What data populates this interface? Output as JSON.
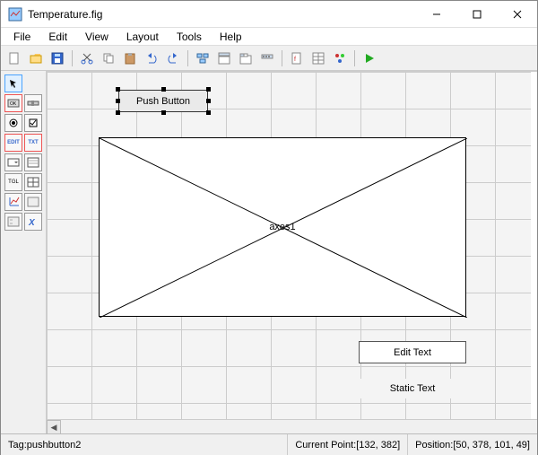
{
  "window": {
    "title": "Temperature.fig"
  },
  "menus": {
    "file": "File",
    "edit": "Edit",
    "view": "View",
    "layout": "Layout",
    "tools": "Tools",
    "help": "Help"
  },
  "toolbar_icons": {
    "new": "new-icon",
    "open": "open-icon",
    "save": "save-icon",
    "cut": "cut-icon",
    "copy": "copy-icon",
    "paste": "paste-icon",
    "undo": "undo-icon",
    "redo": "redo-icon",
    "align": "align-icon",
    "mfile": "mfile-icon",
    "prop": "property-icon",
    "objbrowser": "object-browser-icon",
    "tabeditor": "tab-icon",
    "toolbareditor": "toolbar-editor-icon",
    "run": "run-icon"
  },
  "palette": {
    "select": "select-tool",
    "pushbutton": "OK",
    "slider": "slider",
    "radio": "radio",
    "checkbox": "check",
    "edit": "EDIT",
    "text": "TXT",
    "popup": "popup",
    "listbox": "list",
    "toggle": "TGL",
    "table": "table",
    "axes": "axes",
    "panel": "panel",
    "bgroup": "bgroup",
    "activex": "X"
  },
  "canvas": {
    "pushbutton_label": "Push Button",
    "axes_label": "axes1",
    "edittext_label": "Edit Text",
    "statictext_label": "Static Text"
  },
  "status": {
    "tag_label": "Tag: ",
    "tag_value": "pushbutton2",
    "currentpoint_label": "Current Point:   ",
    "currentpoint_value": "[132, 382]",
    "position_label": "Position: ",
    "position_value": "[50, 378, 101, 49]"
  }
}
